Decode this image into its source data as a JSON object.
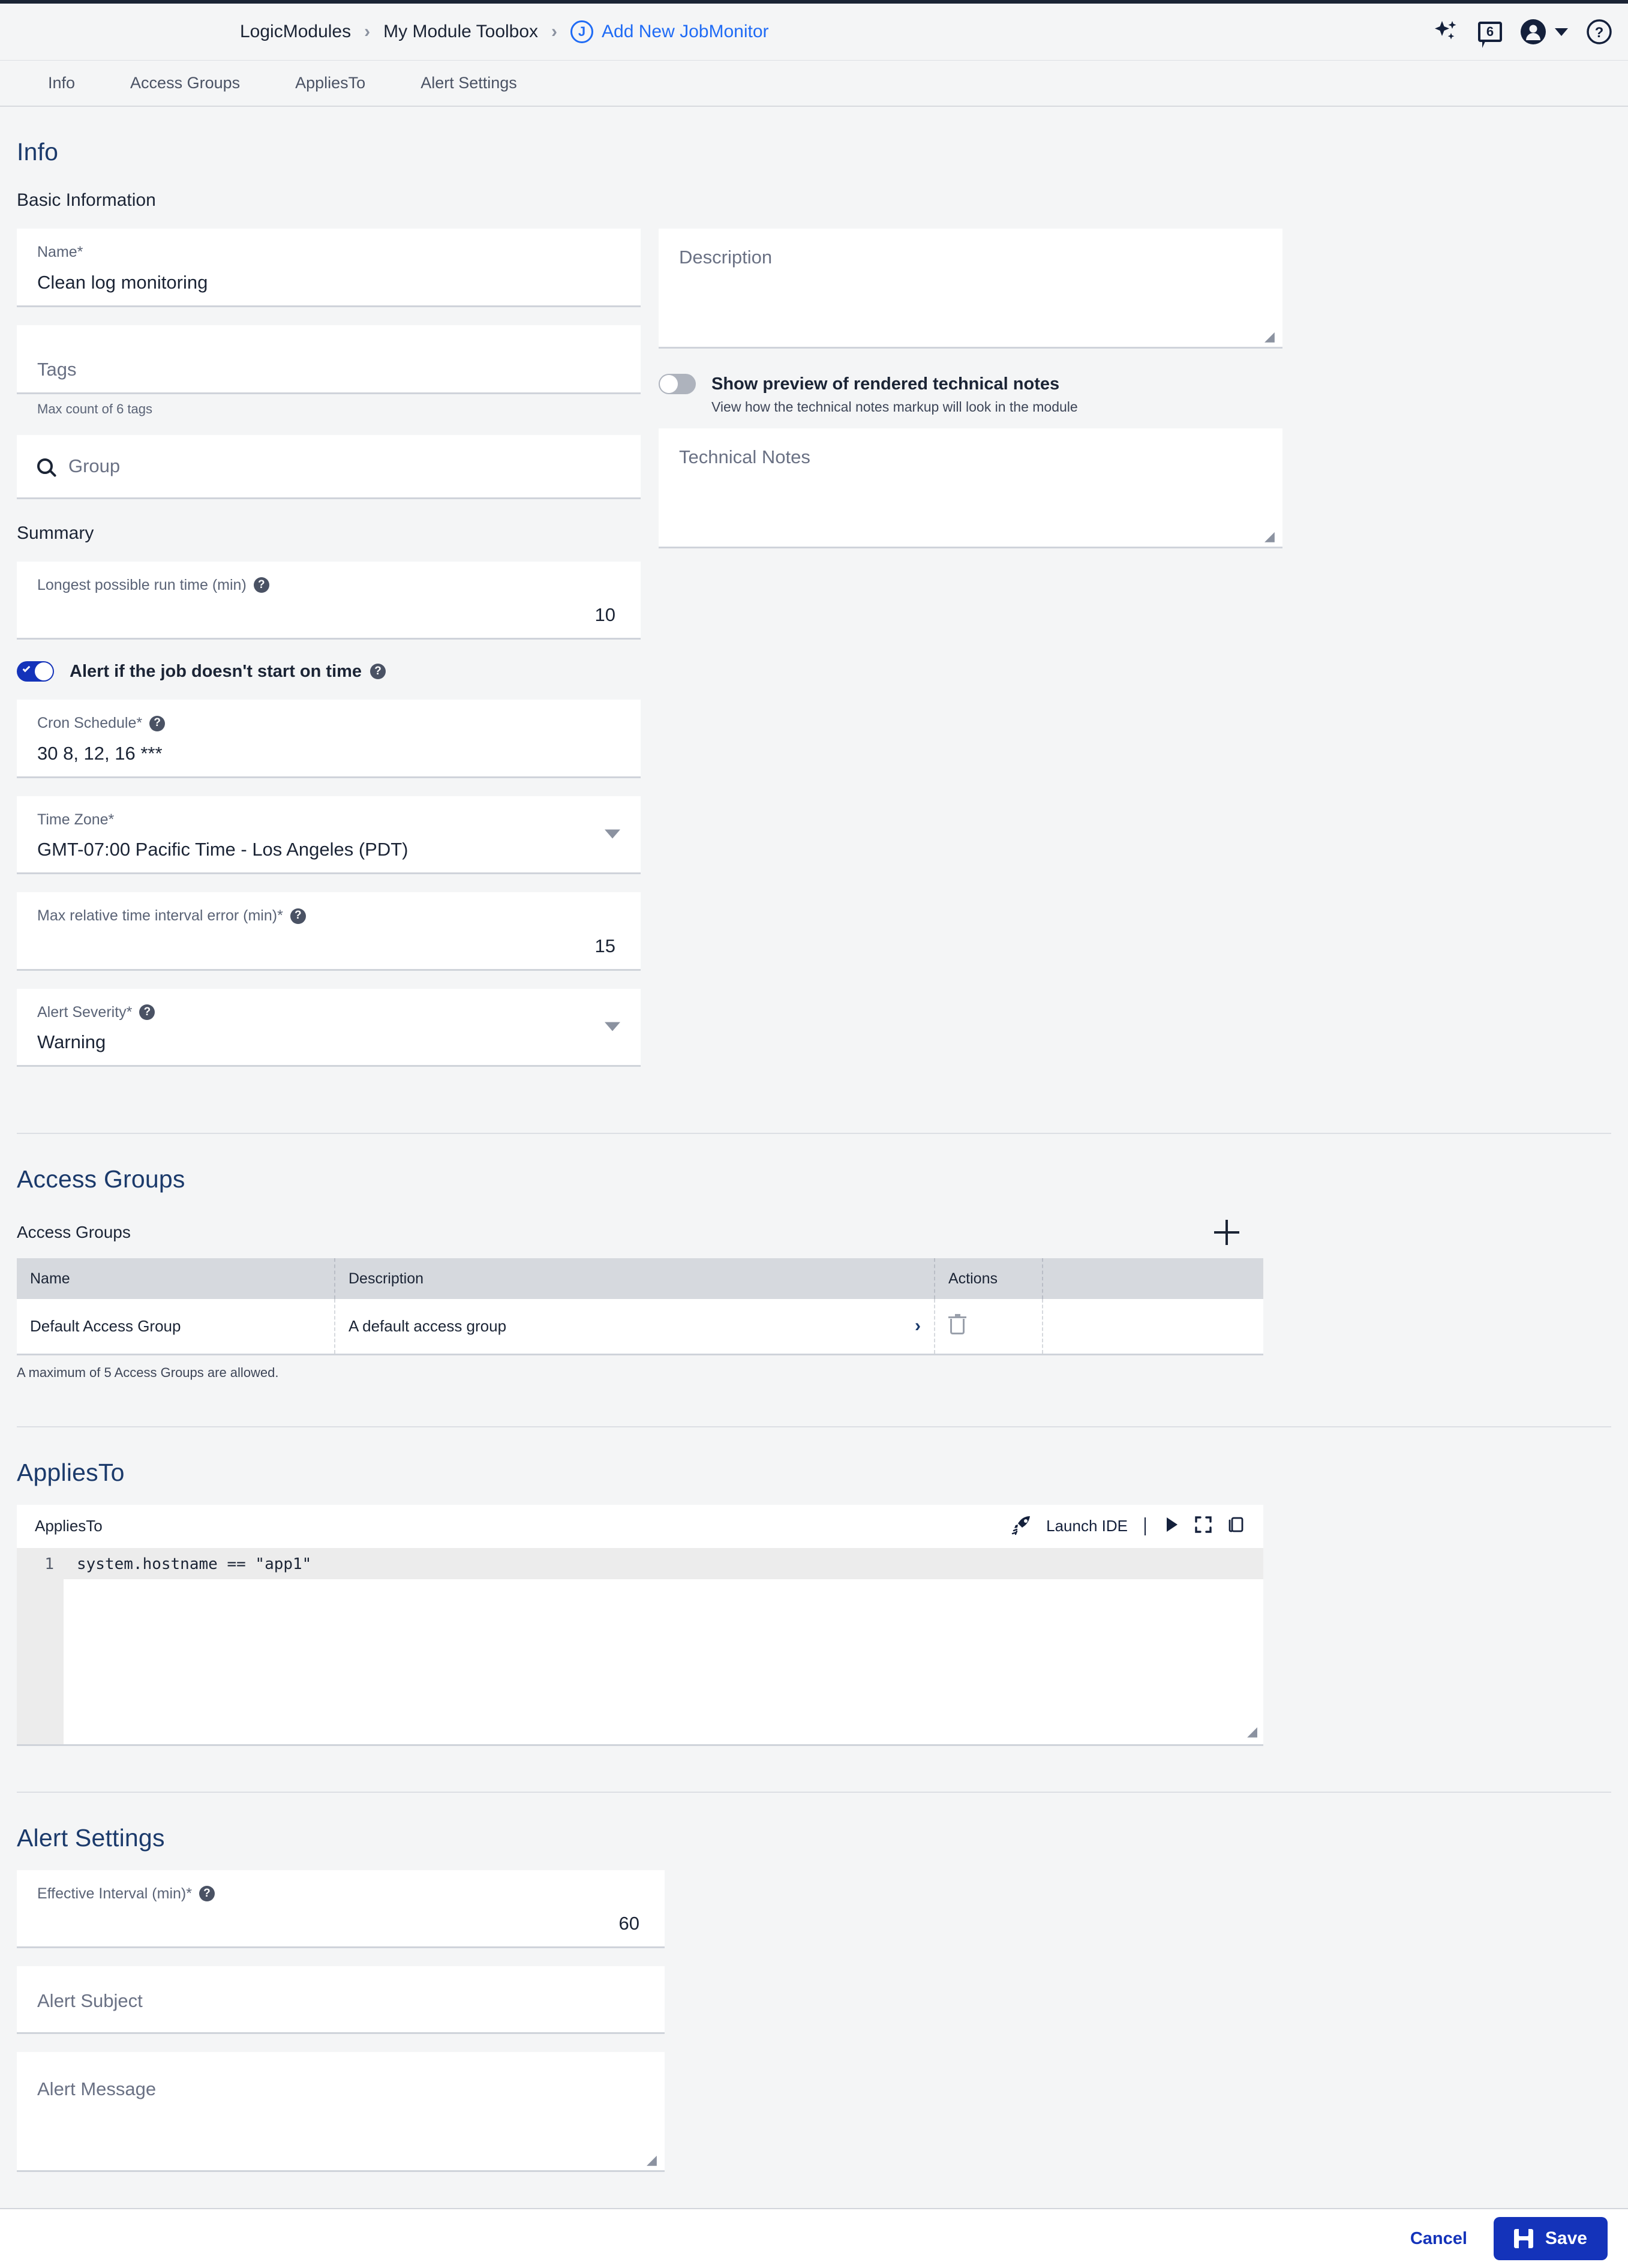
{
  "header": {
    "breadcrumb": {
      "root": "LogicModules",
      "parent": "My Module Toolbox",
      "separator": "›",
      "current": "Add New JobMonitor",
      "current_badge": "J"
    },
    "icons": {
      "ai": "sparkle-icon",
      "notifications": "notification-icon",
      "notification_count": "6",
      "account": "account-icon",
      "help": "help-icon"
    }
  },
  "tabs": [
    {
      "label": "Info",
      "active": true
    },
    {
      "label": "Access Groups",
      "active": false
    },
    {
      "label": "AppliesTo",
      "active": false
    },
    {
      "label": "Alert Settings",
      "active": false
    }
  ],
  "info": {
    "section_title": "Info",
    "basic_information_label": "Basic Information",
    "name": {
      "label": "Name*",
      "value": "Clean log monitoring"
    },
    "tags": {
      "placeholder": "Tags",
      "helper": "Max count of 6 tags"
    },
    "group": {
      "placeholder": "Group",
      "icon": "search-icon"
    },
    "description": {
      "placeholder": "Description"
    },
    "tech_notes_toggle": {
      "label": "Show preview of rendered technical notes",
      "sublabel": "View how the technical notes markup will look in the module",
      "state": "off"
    },
    "technical_notes": {
      "placeholder": "Technical Notes"
    }
  },
  "summary": {
    "title": "Summary",
    "longest_run_time": {
      "label": "Longest possible run time (min)",
      "value": "10"
    },
    "alert_if_not_started": {
      "label": "Alert if the job doesn't start on time",
      "state": "on"
    },
    "cron_schedule": {
      "label": "Cron Schedule*",
      "value": "30 8, 12, 16 ***"
    },
    "time_zone": {
      "label": "Time Zone*",
      "value": "GMT-07:00 Pacific Time - Los Angeles (PDT)"
    },
    "max_interval_error": {
      "label": "Max relative time interval error (min)*",
      "value": "15"
    },
    "alert_severity": {
      "label": "Alert Severity*",
      "value": "Warning"
    }
  },
  "access_groups": {
    "section_title": "Access Groups",
    "table_title": "Access Groups",
    "add_button": "add-access-group",
    "columns": [
      "Name",
      "Description",
      "Actions",
      ""
    ],
    "rows": [
      {
        "name": "Default Access Group",
        "description": "A default access group"
      }
    ],
    "note": "A maximum of 5 Access Groups are allowed."
  },
  "applies_to": {
    "section_title": "AppliesTo",
    "editor_label": "AppliesTo",
    "launch_ide": "Launch IDE",
    "line_number": "1",
    "code": "system.hostname == \"app1\""
  },
  "alert_settings": {
    "section_title": "Alert Settings",
    "effective_interval": {
      "label": "Effective Interval (min)*",
      "value": "60"
    },
    "alert_subject": {
      "placeholder": "Alert Subject"
    },
    "alert_message": {
      "placeholder": "Alert Message"
    }
  },
  "footer": {
    "cancel": "Cancel",
    "save": "Save"
  },
  "colors": {
    "accent": "#1433ba",
    "link": "#1f6bf5",
    "heading": "#1b3a6b",
    "page_bg": "#f4f5f6"
  }
}
